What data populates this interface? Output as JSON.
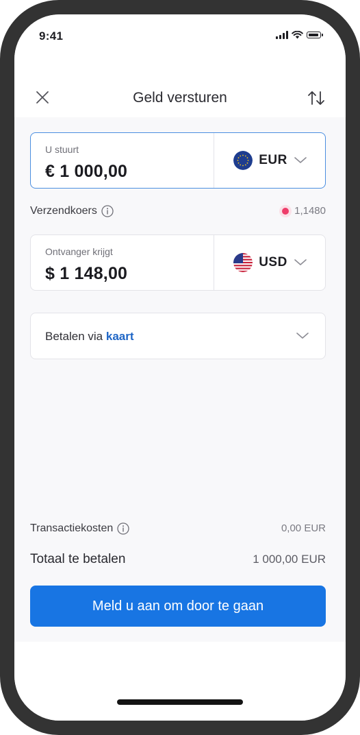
{
  "status_bar": {
    "time": "9:41"
  },
  "header": {
    "title": "Geld versturen",
    "close_icon": "close-icon",
    "swap_icon": "swap-vertical-icon"
  },
  "send": {
    "label": "U stuurt",
    "amount": "€ 1 000,00",
    "currency": "EUR",
    "flag": "eu-flag-icon"
  },
  "rate": {
    "label": "Verzendkoers",
    "value": "1,1480",
    "indicator_color": "#ee3d6a"
  },
  "receive": {
    "label": "Ontvanger krijgt",
    "amount": "$ 1 148,00",
    "currency": "USD",
    "flag": "us-flag-icon"
  },
  "payment": {
    "prefix": "Betalen via",
    "method": "kaart"
  },
  "fees": {
    "label": "Transactiekosten",
    "value": "0,00 EUR"
  },
  "total": {
    "label": "Totaal te betalen",
    "value": "1 000,00 EUR"
  },
  "cta": {
    "label": "Meld u aan om door te gaan"
  },
  "colors": {
    "accent": "#1875e3",
    "link": "#1f66c6",
    "frame": "#333333",
    "active_border": "#4a8ee0"
  }
}
